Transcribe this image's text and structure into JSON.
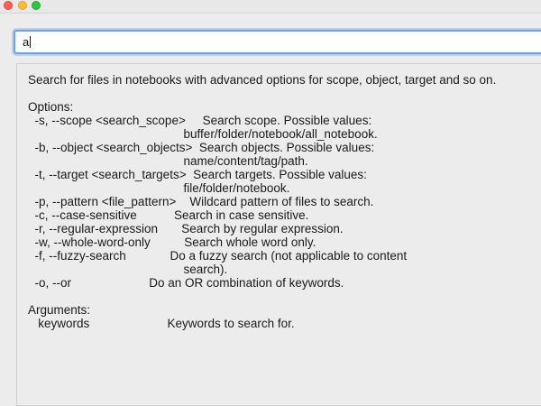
{
  "window": {
    "traffic_lights": {
      "close_color": "#ff5f57",
      "minimize_color": "#febc2e",
      "maximize_color": "#28c840"
    }
  },
  "search": {
    "value": "a"
  },
  "help": {
    "text": "Search for files in notebooks with advanced options for scope, object, target and so on.\n\nOptions:\n  -s, --scope <search_scope>     Search scope. Possible values:\n                                              buffer/folder/notebook/all_notebook.\n  -b, --object <search_objects>  Search objects. Possible values:\n                                              name/content/tag/path.\n  -t, --target <search_targets>  Search targets. Possible values:\n                                              file/folder/notebook.\n  -p, --pattern <file_pattern>    Wildcard pattern of files to search.\n  -c, --case-sensitive           Search in case sensitive.\n  -r, --regular-expression       Search by regular expression.\n  -w, --whole-word-only          Search whole word only.\n  -f, --fuzzy-search             Do a fuzzy search (not applicable to content\n                                              search).\n  -o, --or                       Do an OR combination of keywords.\n\nArguments:\n   keywords                       Keywords to search for."
  }
}
